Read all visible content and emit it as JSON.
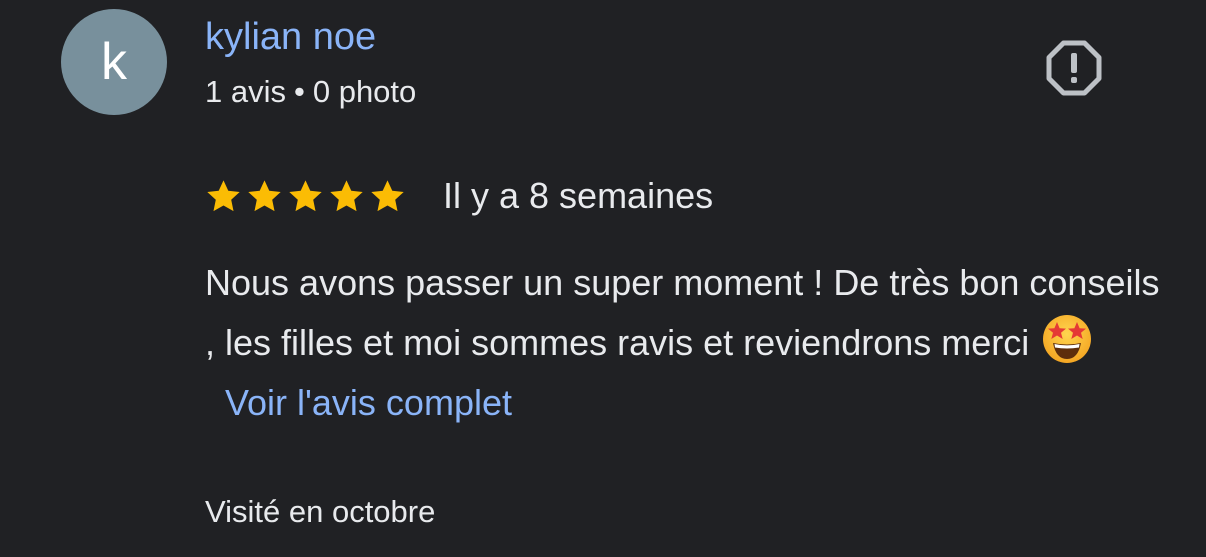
{
  "review": {
    "author": {
      "initial": "k",
      "name": "kylian noe",
      "review_count": "1 avis",
      "separator": "•",
      "photo_count": "0 photo",
      "avatar_color": "#78909c"
    },
    "report_icon": "report-flag-icon",
    "rating": {
      "stars": 5,
      "max_stars": 5,
      "star_color": "#fbbc04",
      "date": "Il y a 8 semaines"
    },
    "text": "Nous avons passer un super moment ! De très bon conseils , les filles et moi sommes ravis et reviendrons merci",
    "emoji": "star-struck-emoji",
    "read_more_label": "Voir l'avis complet",
    "visited": "Visité en octobre"
  },
  "colors": {
    "background": "#202124",
    "text": "#e8eaed",
    "link": "#8ab4f8"
  }
}
